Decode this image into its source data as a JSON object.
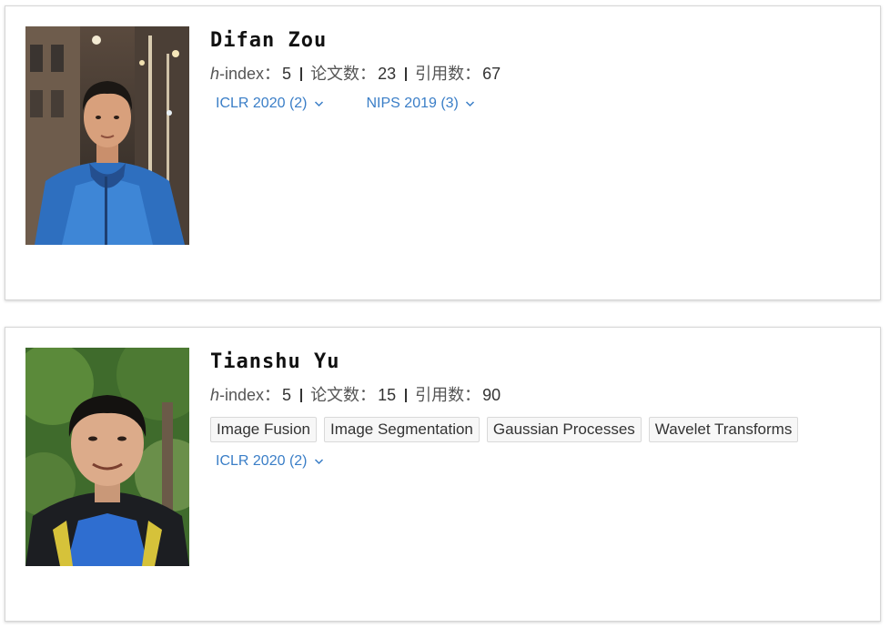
{
  "labels": {
    "h_prefix": "h",
    "h_suffix": "-index：",
    "papers": "论文数：",
    "citations": "引用数："
  },
  "authors": [
    {
      "name": "Difan Zou",
      "h_index": "5",
      "papers": "23",
      "citations": "67",
      "tags": [],
      "confs": [
        "ICLR 2020 (2)",
        "NIPS 2019 (3)"
      ]
    },
    {
      "name": "Tianshu Yu",
      "h_index": "5",
      "papers": "15",
      "citations": "90",
      "tags": [
        "Image Fusion",
        "Image Segmentation",
        "Gaussian Processes",
        "Wavelet Transforms"
      ],
      "confs": [
        "ICLR 2020 (2)"
      ]
    }
  ],
  "colors": {
    "link": "#3a7ec7",
    "card_border": "#d6d6d6",
    "tag_bg": "#f7f7f7"
  },
  "icons": [
    "chevron-down-icon"
  ]
}
